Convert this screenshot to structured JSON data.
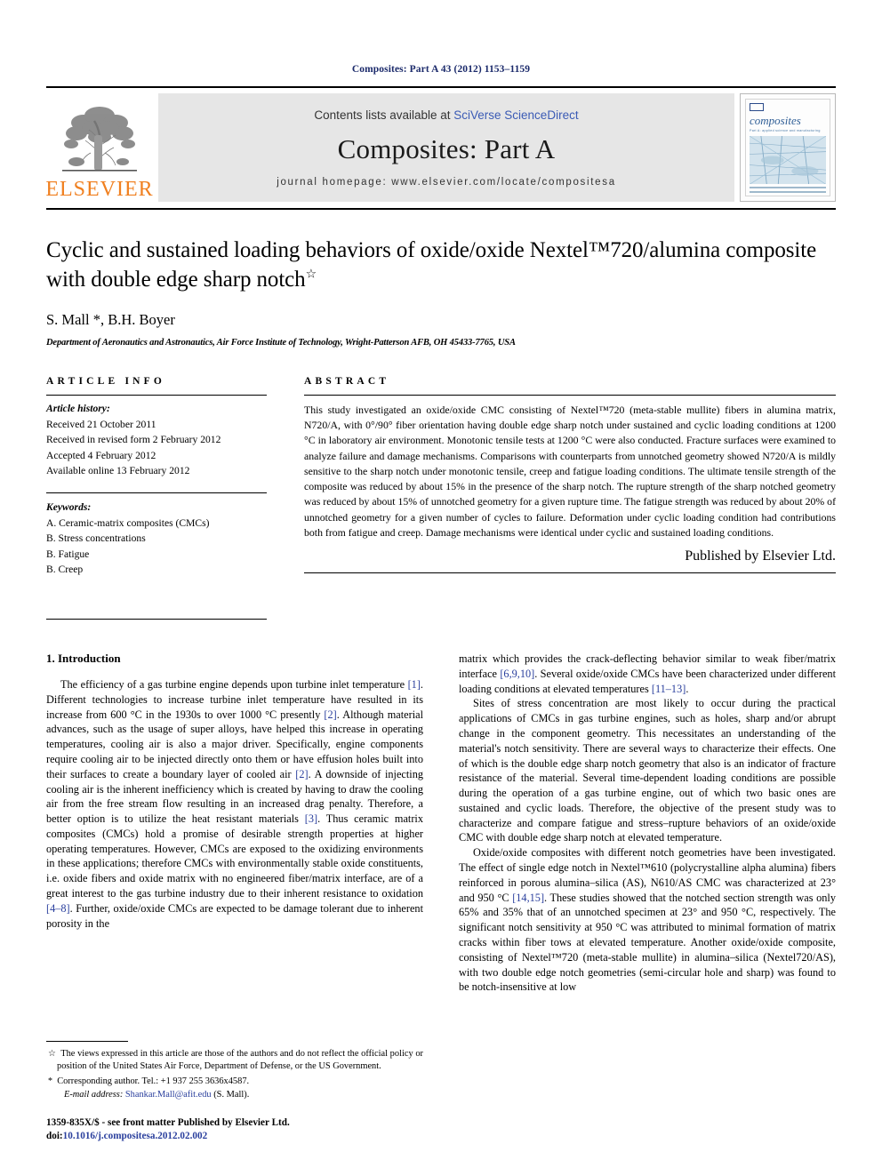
{
  "running_head": "Composites: Part A 43 (2012) 1153–1159",
  "masthead": {
    "contents_prefix": "Contents lists available at ",
    "contents_link": "SciVerse ScienceDirect",
    "journal_title": "Composites: Part A",
    "homepage": "journal homepage: www.elsevier.com/locate/compositesa",
    "publisher_name": "ELSEVIER",
    "cover_word": "composites",
    "cover_subtitle": "Part A: applied science and manufacturing",
    "link_color": "#3b5bb5",
    "brand_orange": "#f08020"
  },
  "article": {
    "title": "Cyclic and sustained loading behaviors of oxide/oxide Nextel™720/alumina composite with double edge sharp notch",
    "title_footnote_symbol": "☆",
    "authors": "S. Mall *, B.H. Boyer",
    "affiliation": "Department of Aeronautics and Astronautics, Air Force Institute of Technology, Wright-Patterson AFB, OH 45433-7765, USA"
  },
  "article_info": {
    "heading": "ARTICLE INFO",
    "history_label": "Article history:",
    "history": [
      "Received 21 October 2011",
      "Received in revised form 2 February 2012",
      "Accepted 4 February 2012",
      "Available online 13 February 2012"
    ],
    "keywords_label": "Keywords:",
    "keywords": [
      "A. Ceramic-matrix composites (CMCs)",
      "B. Stress concentrations",
      "B. Fatigue",
      "B. Creep"
    ]
  },
  "abstract": {
    "heading": "ABSTRACT",
    "text": "This study investigated an oxide/oxide CMC consisting of Nextel™720 (meta-stable mullite) fibers in alumina matrix, N720/A, with 0°/90° fiber orientation having double edge sharp notch under sustained and cyclic loading conditions at 1200 °C in laboratory air environment. Monotonic tensile tests at 1200 °C were also conducted. Fracture surfaces were examined to analyze failure and damage mechanisms. Comparisons with counterparts from unnotched geometry showed N720/A is mildly sensitive to the sharp notch under monotonic tensile, creep and fatigue loading conditions. The ultimate tensile strength of the composite was reduced by about 15% in the presence of the sharp notch. The rupture strength of the sharp notched geometry was reduced by about 15% of unnotched geometry for a given rupture time. The fatigue strength was reduced by about 20% of unnotched geometry for a given number of cycles to failure. Deformation under cyclic loading condition had contributions both from fatigue and creep. Damage mechanisms were identical under cyclic and sustained loading conditions.",
    "signature": "Published by Elsevier Ltd."
  },
  "body": {
    "section_number_title": "1. Introduction",
    "left_paragraph_1_a": "The efficiency of a gas turbine engine depends upon turbine inlet temperature ",
    "cite_1": "[1]",
    "left_paragraph_1_b": ". Different technologies to increase turbine inlet temperature have resulted in its increase from 600 °C in the 1930s to over 1000 °C presently ",
    "cite_2": "[2]",
    "left_paragraph_1_c": ". Although material advances, such as the usage of super alloys, have helped this increase in operating temperatures, cooling air is also a major driver. Specifically, engine components require cooling air to be injected directly onto them or have effusion holes built into their surfaces to create a boundary layer of cooled air ",
    "cite_2b": "[2]",
    "left_paragraph_1_d": ". A downside of injecting cooling air is the inherent inefficiency which is created by having to draw the cooling air from the free stream flow resulting in an increased drag penalty. Therefore, a better option is to utilize the heat resistant materials ",
    "cite_3": "[3]",
    "left_paragraph_1_e": ". Thus ceramic matrix composites (CMCs) hold a promise of desirable strength properties at higher operating temperatures. However, CMCs are exposed to the oxidizing environments in these applications; therefore CMCs with environmentally stable oxide constituents, i.e. oxide fibers and oxide matrix with no engineered fiber/matrix interface, are of a great interest to the gas turbine industry due to their inherent resistance to oxidation ",
    "cite_4_8": "[4–8]",
    "left_paragraph_1_f": ". Further, oxide/oxide CMCs are expected to be damage tolerant due to inherent porosity in the",
    "right_paragraph_1_a": "matrix which provides the crack-deflecting behavior similar to weak fiber/matrix interface ",
    "cite_6_9_10": "[6,9,10]",
    "right_paragraph_1_b": ". Several oxide/oxide CMCs have been characterized under different loading conditions at elevated temperatures ",
    "cite_11_13": "[11–13]",
    "right_paragraph_1_c": ".",
    "right_paragraph_2": "Sites of stress concentration are most likely to occur during the practical applications of CMCs in gas turbine engines, such as holes, sharp and/or abrupt change in the component geometry. This necessitates an understanding of the material's notch sensitivity. There are several ways to characterize their effects. One of which is the double edge sharp notch geometry that also is an indicator of fracture resistance of the material. Several time-dependent loading conditions are possible during the operation of a gas turbine engine, out of which two basic ones are sustained and cyclic loads. Therefore, the objective of the present study was to characterize and compare fatigue and stress–rupture behaviors of an oxide/oxide CMC with double edge sharp notch at elevated temperature.",
    "right_paragraph_3_a": "Oxide/oxide composites with different notch geometries have been investigated. The effect of single edge notch in Nextel™610 (polycrystalline alpha alumina) fibers reinforced in porous alumina–silica (AS), N610/AS CMC was characterized at 23° and 950 °C ",
    "cite_14_15": "[14,15]",
    "right_paragraph_3_b": ". These studies showed that the notched section strength was only 65% and 35% that of an unnotched specimen at 23° and 950 °C, respectively. The significant notch sensitivity at 950 °C was attributed to minimal formation of matrix cracks within fiber tows at elevated temperature. Another oxide/oxide composite, consisting of Nextel™720 (meta-stable mullite) in alumina–silica (Nextel720/AS), with two double edge notch geometries (semi-circular hole and sharp) was found to be notch-insensitive at low"
  },
  "footnotes": {
    "disclaimer_symbol": "☆",
    "disclaimer": "The views expressed in this article are those of the authors and do not reflect the official policy or position of the United States Air Force, Department of Defense, or the US Government.",
    "corresponding_symbol": "*",
    "corresponding": "Corresponding author. Tel.: +1 937 255 3636x4587.",
    "email_label": "E-mail address:",
    "email": "Shankar.Mall@afit.edu",
    "email_owner": "(S. Mall)."
  },
  "imprint": {
    "line1": "1359-835X/$ - see front matter Published by Elsevier Ltd.",
    "doi_label": "doi:",
    "doi": "10.1016/j.compositesa.2012.02.002"
  }
}
